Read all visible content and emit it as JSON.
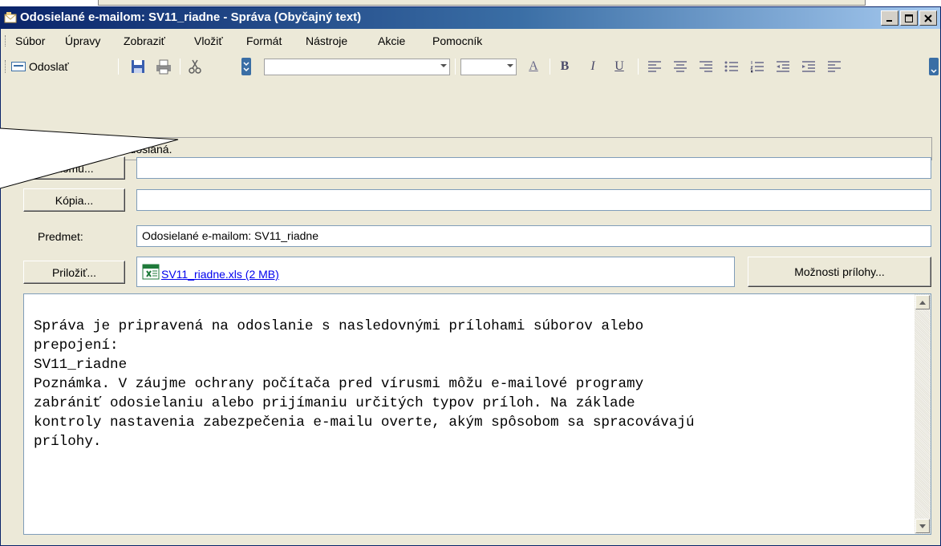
{
  "window": {
    "title": "Odosielané e-mailom: SV11_riadne - Správa (Obyčajný text)",
    "controls": [
      "minimize",
      "maximize",
      "close"
    ]
  },
  "menu": [
    "Súbor",
    "Úpravy",
    "Zobraziť",
    "Vložiť",
    "Formát",
    "Nástroje",
    "Akcie",
    "Pomocník"
  ],
  "toolbar": {
    "send_label": "Odoslať",
    "icons": [
      "send-icon",
      "save-icon",
      "print-icon",
      "cut-icon",
      "font-color-icon",
      "bold-icon",
      "italic-icon",
      "underline-icon",
      "align-left-icon",
      "align-center-icon",
      "align-right-icon",
      "bullets-icon",
      "numbering-icon",
      "decrease-indent-icon",
      "increase-indent-icon",
      "style-icon"
    ],
    "bold": "B",
    "italic": "I",
    "underline": "U"
  },
  "info_bar": "Táto správa nebola odoslaná.",
  "fields": {
    "to_button": "Komu...",
    "to_value": "",
    "cc_button": "Kópia...",
    "cc_value": "",
    "subject_label": "Predmet:",
    "subject_value": "Odosielané e-mailom: SV11_riadne",
    "attach_button": "Priložiť...",
    "attachment_name": "SV11_riadne.xls (2 MB)",
    "attachment_options_button": "Možnosti prílohy..."
  },
  "body_lines": [
    "Správa je pripravená na odoslanie s nasledovnými prílohami súborov alebo",
    "prepojení:",
    "",
    "SV11_riadne",
    "",
    "",
    "Poznámka. V záujme ochrany počítača pred vírusmi môžu e-mailové programy",
    "zabrániť odosielaniu alebo prijímaniu určitých typov príloh. Na základe",
    "kontroly nastavenia zabezpečenia e-mailu overte, akým spôsobom sa spracovávajú",
    "prílohy."
  ],
  "colors": {
    "title_start": "#0a246a",
    "title_end": "#a6caf0",
    "chrome": "#ece9d8",
    "field_border": "#7f9db9"
  }
}
